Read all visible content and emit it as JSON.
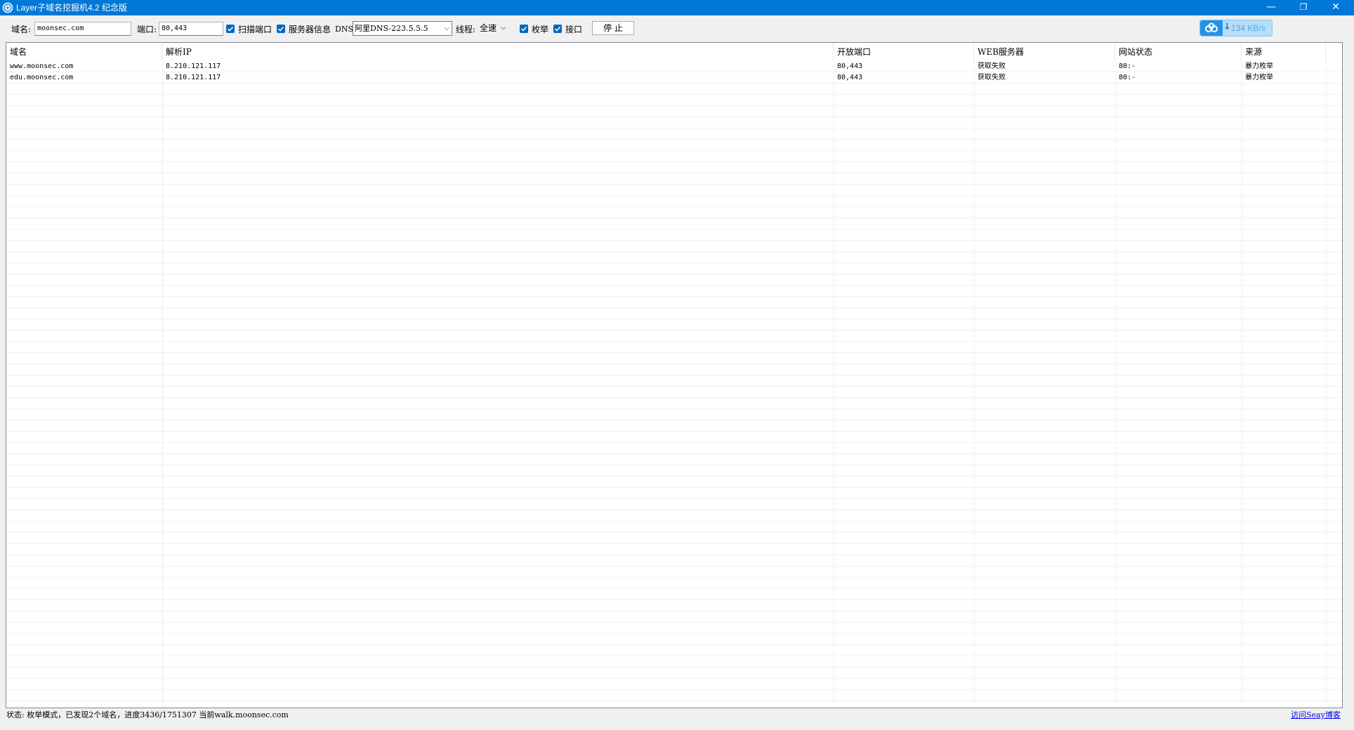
{
  "window": {
    "title": "Layer子域名挖掘机4.2 纪念版",
    "controls": {
      "minimize": "—",
      "restore": "❐",
      "close": "✕"
    }
  },
  "toolbar": {
    "domain_label": "域名:",
    "domain_value": "moonsec.com",
    "port_label": "端口:",
    "port_value": "80,443",
    "scan_port_label": "扫描端口",
    "scan_port_checked": true,
    "server_info_label": "服务器信息",
    "server_info_checked": true,
    "dns_label": "DNS:",
    "dns_value": "阿里DNS-223.5.5.5",
    "thread_label": "线程:",
    "thread_value": "全速",
    "enum_label": "枚举",
    "enum_checked": true,
    "api_label": "接口",
    "api_checked": true,
    "stop_button": "停 止"
  },
  "network_widget": {
    "speed": "134 KB/s",
    "icon": "cloud-download-icon"
  },
  "table": {
    "columns": [
      "域名",
      "解析IP",
      "开放端口",
      "WEB服务器",
      "网站状态",
      "来源"
    ],
    "rows": [
      [
        "www.moonsec.com",
        "8.210.121.117",
        "80,443",
        "获取失败",
        "80:-",
        "暴力枚举"
      ],
      [
        "edu.moonsec.com",
        "8.210.121.117",
        "80,443",
        "获取失败",
        "80:-",
        "暴力枚举"
      ]
    ]
  },
  "statusbar": {
    "text": "状态: 枚举模式，已发现2个域名，进度3436/1751307   当前walk.moonsec.com",
    "link": "访问Seay博客"
  },
  "colors": {
    "titlebar": "#0078d7",
    "checkbox": "#0067c0",
    "link": "#0000ee"
  }
}
